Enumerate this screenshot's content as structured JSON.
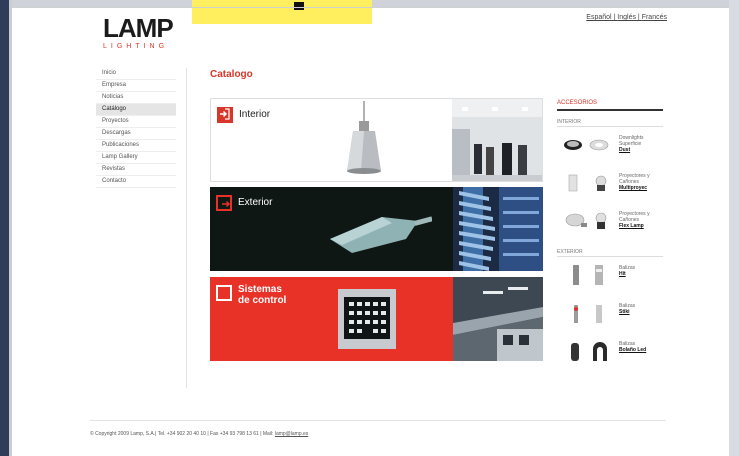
{
  "brand": {
    "name": "LAMP",
    "tagline": "LIGHTING",
    "accent": "#d8362a"
  },
  "languages": [
    {
      "label": "Español"
    },
    {
      "label": "Inglés"
    },
    {
      "label": "Francés"
    }
  ],
  "sidebar": {
    "items": [
      {
        "label": "Inicio"
      },
      {
        "label": "Empresa"
      },
      {
        "label": "Noticias"
      },
      {
        "label": "Catálogo",
        "active": true
      },
      {
        "label": "Proyectos"
      },
      {
        "label": "Descargas"
      },
      {
        "label": "Publicaciones"
      },
      {
        "label": "Lamp Gallery"
      },
      {
        "label": "Revistas"
      },
      {
        "label": "Contacto"
      }
    ]
  },
  "page": {
    "title": "Catalogo"
  },
  "catalog": {
    "banners": [
      {
        "label": "Interior",
        "icon": "arrow-in-icon"
      },
      {
        "label": "Exterior",
        "icon": "arrow-out-icon"
      },
      {
        "label_line1": "Sistemas",
        "label_line2": "de control",
        "icon": "square-icon"
      }
    ]
  },
  "accessories": {
    "title": "ACCESORIOS",
    "interior": {
      "heading": "INTERIOR",
      "items": [
        {
          "desc1": "Downlights",
          "desc2": "Superficie",
          "link": "Dust"
        },
        {
          "desc1": "Proyectores y",
          "desc2": "Cañones",
          "link": "Multiproyec"
        },
        {
          "desc1": "Proyectores y",
          "desc2": "Cañones",
          "link": "Flex Lamp"
        }
      ]
    },
    "exterior": {
      "heading": "EXTERIOR",
      "items": [
        {
          "desc1": "Balizas",
          "link": "Hit"
        },
        {
          "desc1": "Balizas",
          "link": "Stiki"
        },
        {
          "desc1": "Balizas",
          "link": "Bolaño Led"
        }
      ]
    }
  },
  "footer": {
    "text": "© Copyright 2009 Lamp, S.A.| Tel. +34 902 20 40 10 | Fax +34 93 798 13 61 | Mail:",
    "email": "lamp@lamp.es"
  }
}
